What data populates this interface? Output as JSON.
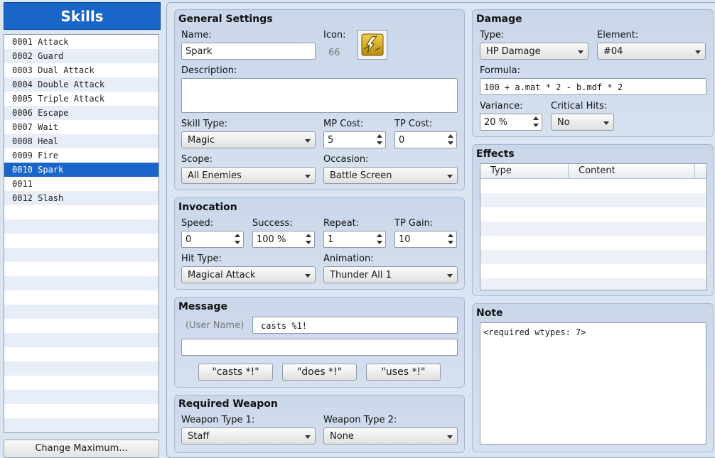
{
  "left": {
    "title": "Skills",
    "skills": [
      "0001 Attack",
      "0002 Guard",
      "0003 Dual Attack",
      "0004 Double Attack",
      "0005 Triple Attack",
      "0006 Escape",
      "0007 Wait",
      "0008 Heal",
      "0009 Fire",
      "0010 Spark",
      "0011",
      "0012 Slash"
    ],
    "selected_index": 9,
    "change_max_label": "Change Maximum..."
  },
  "general": {
    "title": "General Settings",
    "name_label": "Name:",
    "name_value": "Spark",
    "icon_label": "Icon:",
    "icon_index": "66",
    "icon_name": "lightning-icon",
    "description_label": "Description:",
    "description_value": "",
    "skill_type_label": "Skill Type:",
    "skill_type_value": "Magic",
    "mp_cost_label": "MP Cost:",
    "mp_cost_value": "5",
    "tp_cost_label": "TP Cost:",
    "tp_cost_value": "0",
    "scope_label": "Scope:",
    "scope_value": "All Enemies",
    "occasion_label": "Occasion:",
    "occasion_value": "Battle Screen"
  },
  "invocation": {
    "title": "Invocation",
    "speed_label": "Speed:",
    "speed_value": "0",
    "success_label": "Success:",
    "success_value": "100 %",
    "repeat_label": "Repeat:",
    "repeat_value": "1",
    "tp_gain_label": "TP Gain:",
    "tp_gain_value": "10",
    "hit_type_label": "Hit Type:",
    "hit_type_value": "Magical Attack",
    "animation_label": "Animation:",
    "animation_value": "Thunder All 1"
  },
  "message": {
    "title": "Message",
    "user_name_label": "(User Name)",
    "line1_value": "casts %1!",
    "line2_value": "",
    "btn_casts": "\"casts *!\"",
    "btn_does": "\"does *!\"",
    "btn_uses": "\"uses *!\""
  },
  "weapon": {
    "title": "Required Weapon",
    "type1_label": "Weapon Type 1:",
    "type1_value": "Staff",
    "type2_label": "Weapon Type 2:",
    "type2_value": "None"
  },
  "damage": {
    "title": "Damage",
    "type_label": "Type:",
    "type_value": "HP Damage",
    "element_label": "Element:",
    "element_value": "#04",
    "formula_label": "Formula:",
    "formula_value": "100 + a.mat * 2 - b.mdf * 2",
    "variance_label": "Variance:",
    "variance_value": "20 %",
    "critical_label": "Critical Hits:",
    "critical_value": "No"
  },
  "effects": {
    "title": "Effects",
    "col_type": "Type",
    "col_content": "Content"
  },
  "note": {
    "title": "Note",
    "value": "<required wtypes: 7>"
  },
  "colors": {
    "accent": "#1a66c8",
    "panel": "#c9d7ea",
    "background": "#dbe5f2"
  }
}
